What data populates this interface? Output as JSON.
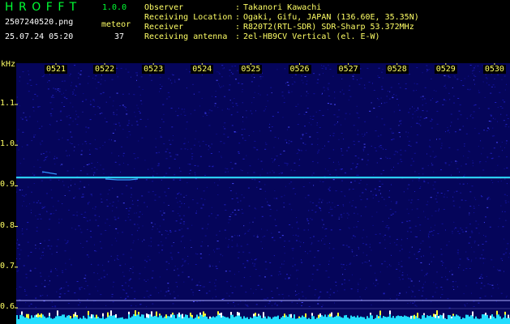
{
  "app": {
    "title": "HROFFT",
    "version": "1.0.0"
  },
  "capture": {
    "file_name": "2507240520.png",
    "timestamp": "25.07.24 05:20",
    "meteor_label": "meteor",
    "meteor_count": "37"
  },
  "station": [
    {
      "label": "Observer",
      "value": "Takanori Kawachi"
    },
    {
      "label": "Receiving Location",
      "value": "Ogaki, Gifu, JAPAN (136.60E, 35.35N)"
    },
    {
      "label": "Receiver",
      "value": "R820T2(RTL-SDR) SDR-Sharp 53.372MHz"
    },
    {
      "label": "Receiving antenna",
      "value": "2el-HB9CV Vertical (el. E-W)"
    }
  ],
  "separator": ":",
  "axis": {
    "unit": "kHz",
    "y_ticks": [
      "1.1",
      "1.0",
      "0.9",
      "0.8",
      "0.7",
      "0.6"
    ],
    "x_ticks": [
      "0521",
      "0522",
      "0523",
      "0524",
      "0525",
      "0526",
      "0527",
      "0528",
      "0529",
      "0530"
    ]
  },
  "colors": {
    "title": "#00ff33",
    "labels": "#ffff66",
    "text": "#ffffff",
    "background": "#000000",
    "noise": "#0a0a7a",
    "carrier": "#22ddff"
  }
}
